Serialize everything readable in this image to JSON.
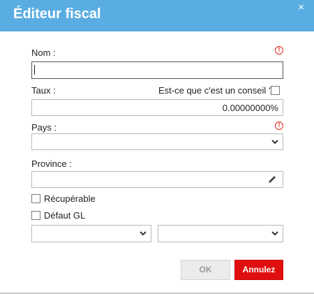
{
  "dialog": {
    "title": "Éditeur fiscal",
    "close_symbol": "×"
  },
  "form": {
    "name_label": "Nom :",
    "name_value": "",
    "rate_label": "Taux :",
    "advice_label": "Est-ce que c'est un conseil ?",
    "advice_checked": false,
    "rate_value": "0.00000000%",
    "country_label": "Pays :",
    "country_value": "",
    "province_label": "Province :",
    "province_value": "",
    "recoverable_label": "Récupérable",
    "recoverable_checked": false,
    "default_gl_label": "Défaut GL",
    "default_gl_checked": false,
    "gl_select_1_value": "",
    "gl_select_2_value": "",
    "required_icon": "!"
  },
  "buttons": {
    "ok_label": "OK",
    "cancel_label": "Annulez"
  },
  "colors": {
    "title_bar": "#5aade2",
    "required": "#e0231b",
    "cancel_button": "#e00f0f"
  }
}
